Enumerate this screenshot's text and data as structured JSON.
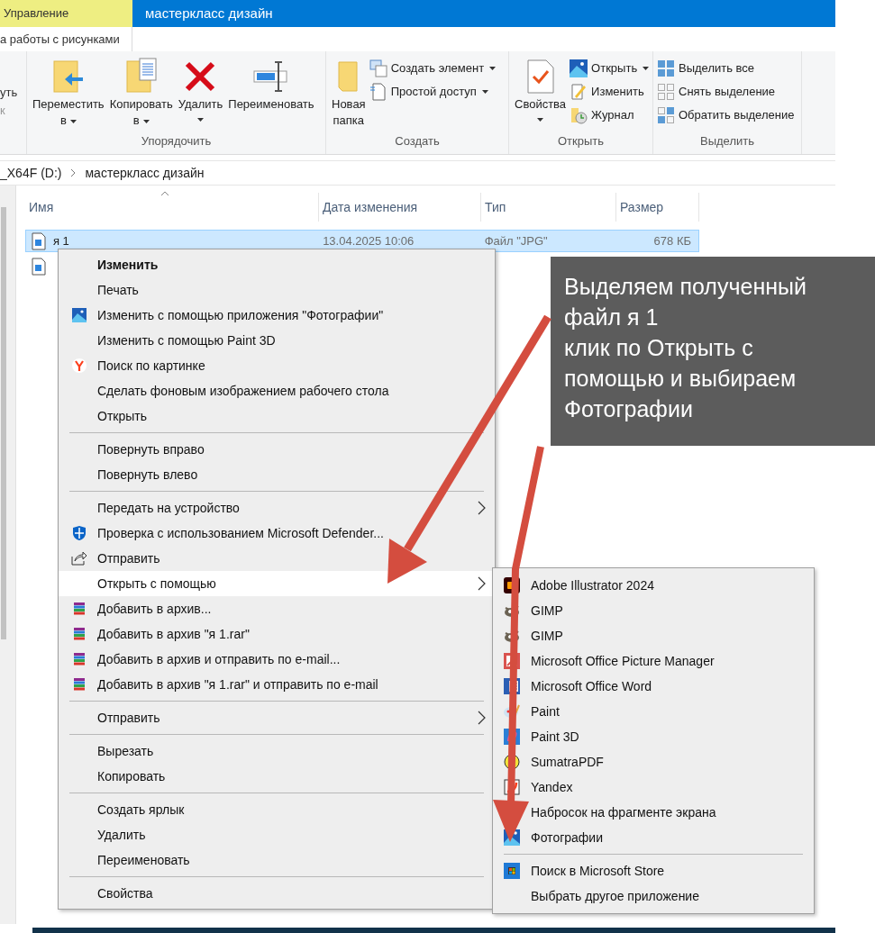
{
  "context_tab": {
    "label": "Управление"
  },
  "window": {
    "title": "мастеркласс дизайн"
  },
  "ribbon_tab": {
    "label": "а работы с рисунками",
    "selected": true
  },
  "ribbon": {
    "clipped_labels": [
      "уть",
      "к"
    ],
    "groups": [
      {
        "label": "Упорядочить",
        "buttons": [
          {
            "kind": "large",
            "lines": [
              "Переместить",
              "в"
            ],
            "dropdown": true
          },
          {
            "kind": "large",
            "lines": [
              "Копировать",
              "в"
            ],
            "dropdown": true
          },
          {
            "kind": "large",
            "lines": [
              "Удалить"
            ],
            "dropdown": true
          },
          {
            "kind": "large",
            "lines": [
              "Переименовать"
            ],
            "dropdown": false
          }
        ]
      },
      {
        "label": "Создать",
        "buttons": [
          {
            "kind": "large",
            "lines": [
              "Новая",
              "папка"
            ],
            "dropdown": false
          },
          {
            "kind": "small",
            "lines": [
              "Создать элемент"
            ],
            "dropdown": true
          },
          {
            "kind": "small",
            "lines": [
              "Простой доступ"
            ],
            "dropdown": true
          }
        ]
      },
      {
        "label": "Открыть",
        "buttons": [
          {
            "kind": "large",
            "lines": [
              "Свойства"
            ],
            "dropdown": true
          },
          {
            "kind": "small",
            "lines": [
              "Открыть"
            ],
            "dropdown": true
          },
          {
            "kind": "small",
            "lines": [
              "Изменить"
            ],
            "dropdown": false
          },
          {
            "kind": "small",
            "lines": [
              "Журнал"
            ],
            "dropdown": false
          }
        ]
      },
      {
        "label": "Выделить",
        "buttons": [
          {
            "kind": "small",
            "lines": [
              "Выделить все"
            ],
            "dropdown": false
          },
          {
            "kind": "small",
            "lines": [
              "Снять выделение"
            ],
            "dropdown": false
          },
          {
            "kind": "small",
            "lines": [
              "Обратить выделение"
            ],
            "dropdown": false
          }
        ]
      }
    ]
  },
  "breadcrumb": [
    "_X64F (D:)",
    "мастеркласс дизайн"
  ],
  "table": {
    "columns": [
      "Имя",
      "Дата изменения",
      "Тип",
      "Размер"
    ],
    "rows": [
      {
        "selected": true,
        "cells": [
          "я 1",
          "13.04.2025 10:06",
          "Файл \"JPG\"",
          "678 КБ"
        ]
      },
      {
        "selected": false,
        "cells": []
      }
    ]
  },
  "context_menu": {
    "groups": [
      [
        {
          "label": "Изменить",
          "default": true,
          "selected": false,
          "submenu": false
        },
        {
          "label": "Печать",
          "default": false,
          "selected": false,
          "submenu": false
        },
        {
          "label": "Изменить с помощью приложения \"Фотографии\"",
          "default": false,
          "selected": false,
          "submenu": false
        },
        {
          "label": "Изменить с помощью Paint 3D",
          "default": false,
          "selected": false,
          "submenu": false
        },
        {
          "label": "Поиск по картинке",
          "default": false,
          "selected": false,
          "submenu": false
        },
        {
          "label": "Сделать фоновым изображением рабочего стола",
          "default": false,
          "selected": false,
          "submenu": false
        },
        {
          "label": "Открыть",
          "default": false,
          "selected": false,
          "submenu": false
        }
      ],
      [
        {
          "label": "Повернуть вправо",
          "default": false,
          "selected": false,
          "submenu": false
        },
        {
          "label": "Повернуть влево",
          "default": false,
          "selected": false,
          "submenu": false
        }
      ],
      [
        {
          "label": "Передать на устройство",
          "default": false,
          "selected": false,
          "submenu": true
        },
        {
          "label": "Проверка с использованием Microsoft Defender...",
          "default": false,
          "selected": false,
          "submenu": false
        },
        {
          "label": "Отправить",
          "default": false,
          "selected": false,
          "submenu": false
        },
        {
          "label": "Открыть с помощью",
          "default": false,
          "selected": true,
          "submenu": true
        },
        {
          "label": "Добавить в архив...",
          "default": false,
          "selected": false,
          "submenu": false
        },
        {
          "label": "Добавить в архив \"я 1.rar\"",
          "default": false,
          "selected": false,
          "submenu": false
        },
        {
          "label": "Добавить в архив и отправить по e-mail...",
          "default": false,
          "selected": false,
          "submenu": false
        },
        {
          "label": "Добавить в архив \"я 1.rar\" и отправить по e-mail",
          "default": false,
          "selected": false,
          "submenu": false
        }
      ],
      [
        {
          "label": "Отправить",
          "default": false,
          "selected": false,
          "submenu": true
        }
      ],
      [
        {
          "label": "Вырезать",
          "default": false,
          "selected": false,
          "submenu": false
        },
        {
          "label": "Копировать",
          "default": false,
          "selected": false,
          "submenu": false
        }
      ],
      [
        {
          "label": "Создать ярлык",
          "default": false,
          "selected": false,
          "submenu": false
        },
        {
          "label": "Удалить",
          "default": false,
          "selected": false,
          "submenu": false
        },
        {
          "label": "Переименовать",
          "default": false,
          "selected": false,
          "submenu": false
        }
      ],
      [
        {
          "label": "Свойства",
          "default": false,
          "selected": false,
          "submenu": false
        }
      ]
    ]
  },
  "open_with_menu": {
    "groups": [
      [
        "Adobe Illustrator 2024",
        "GIMP",
        "GIMP",
        "Microsoft Office Picture Manager",
        "Microsoft Office Word",
        "Paint",
        "Paint 3D",
        "SumatraPDF",
        "Yandex",
        "Набросок на фрагменте экрана",
        "Фотографии"
      ],
      [
        "Поиск в Microsoft Store",
        "Выбрать другое приложение"
      ]
    ]
  },
  "annotation": {
    "lines": [
      "Выделяем полученный",
      "файл я 1",
      "клик по Открыть с",
      "помощью и выбираем",
      "Фотографии"
    ]
  }
}
